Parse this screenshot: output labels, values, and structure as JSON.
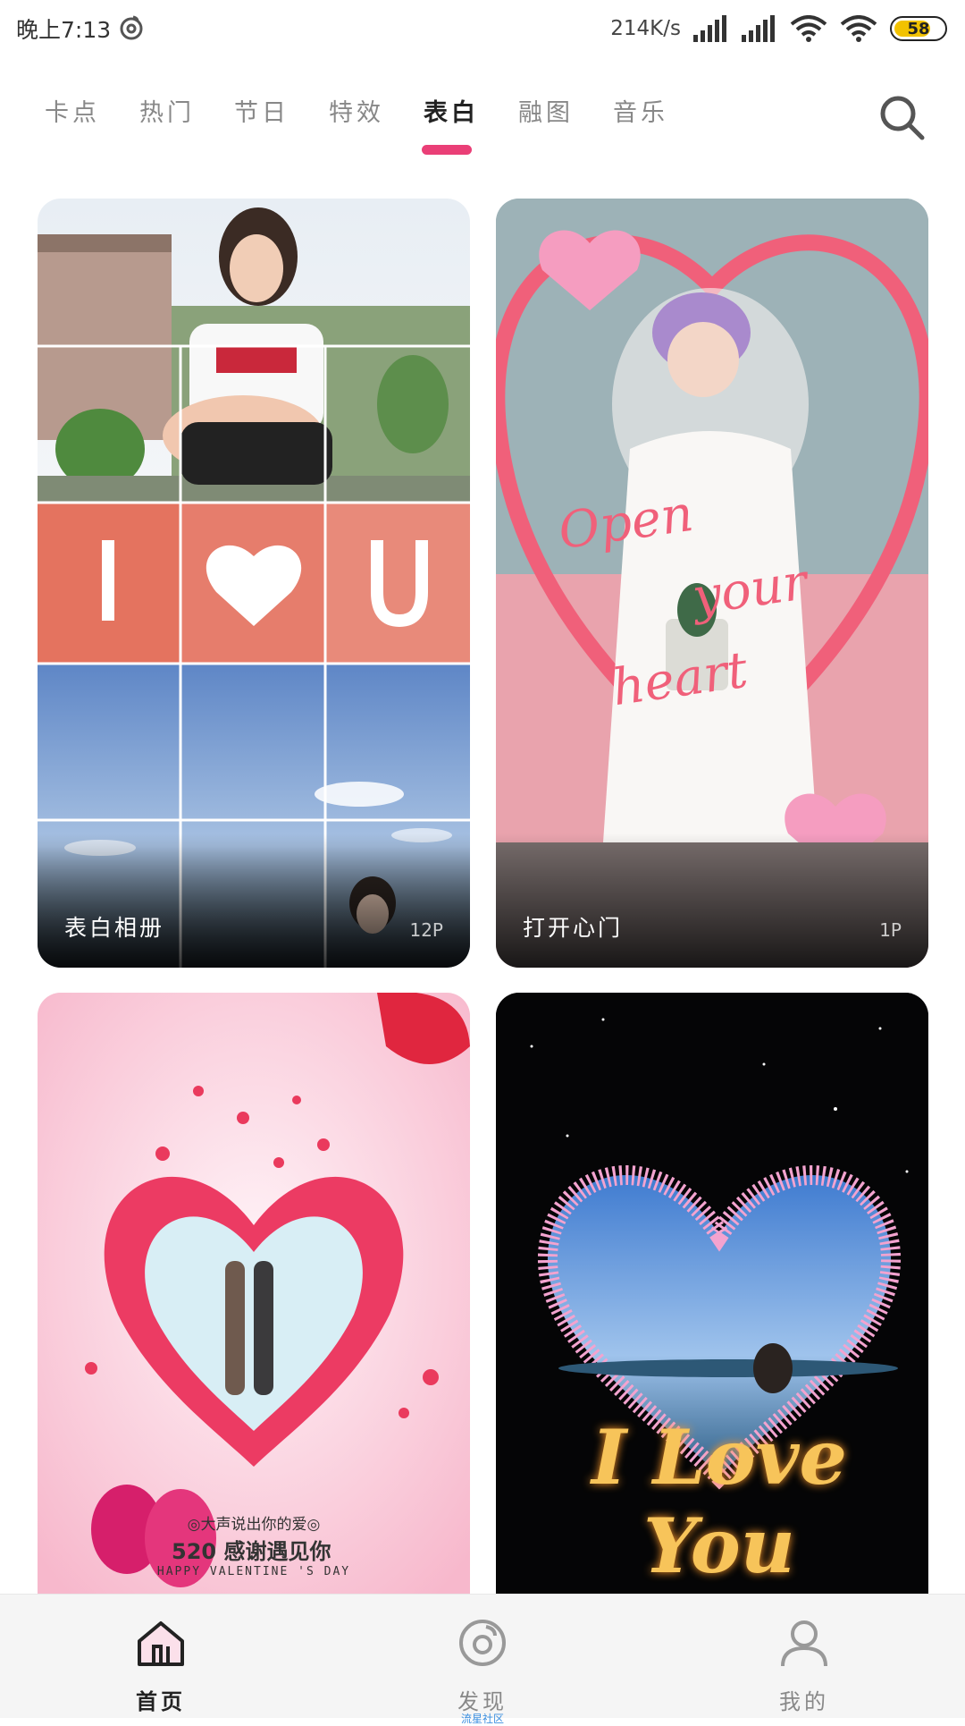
{
  "status_bar": {
    "time": "晚上7:13",
    "net_speed": "214K/s",
    "battery_level": "58",
    "battery_color": "#f2c200"
  },
  "tabs": [
    {
      "label": "卡点",
      "active": false
    },
    {
      "label": "热门",
      "active": false
    },
    {
      "label": "节日",
      "active": false
    },
    {
      "label": "特效",
      "active": false
    },
    {
      "label": "表白",
      "active": true
    },
    {
      "label": "融图",
      "active": false
    },
    {
      "label": "音乐",
      "active": false
    }
  ],
  "accent_color": "#ea3f77",
  "cards": [
    {
      "title": "表白相册",
      "count": "12P",
      "overlay_text": [
        "I",
        "U"
      ]
    },
    {
      "title": "打开心门",
      "count": "1P",
      "overlay_text": [
        "Open",
        "your",
        "heart"
      ]
    },
    {
      "title": "",
      "count": "",
      "overlay_text": [
        "◎大声说出你的爱◎",
        "520 感谢遇见你",
        "HAPPY VALENTINE 'S DAY"
      ]
    },
    {
      "title": "",
      "count": "",
      "overlay_text": [
        "I Love You"
      ]
    }
  ],
  "bottom_nav": [
    {
      "label": "首页",
      "icon": "home-icon",
      "active": true
    },
    {
      "label": "发现",
      "sublabel": "流星社区",
      "icon": "discover-icon",
      "active": false
    },
    {
      "label": "我的",
      "icon": "profile-icon",
      "active": false
    }
  ]
}
